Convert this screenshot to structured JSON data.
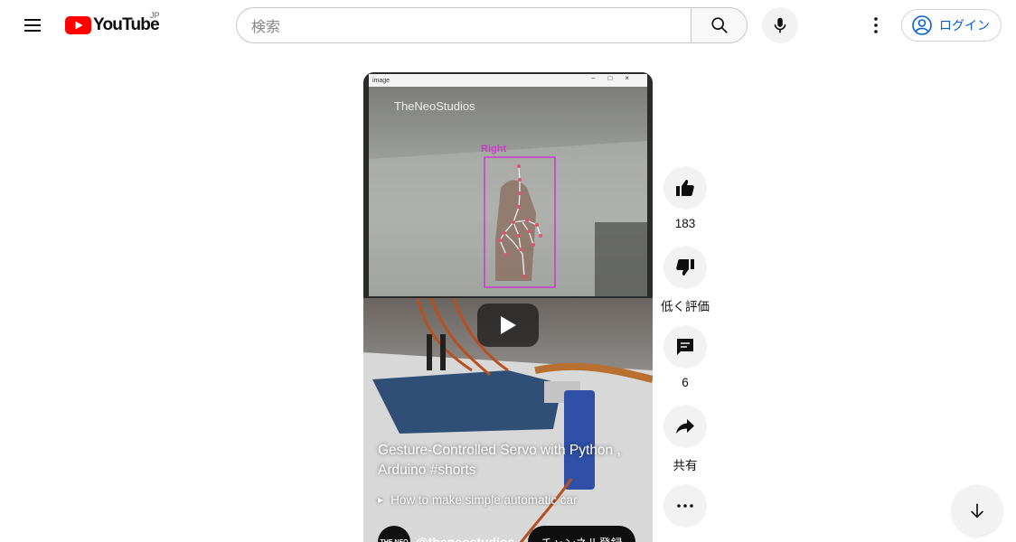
{
  "header": {
    "logo_text": "YouTube",
    "region": "JP",
    "search_placeholder": "検索",
    "login_label": "ログイン"
  },
  "video": {
    "window_title": "image",
    "watermark": "TheNeoStudios",
    "detection_label": "Right",
    "title": "Gesture-Controlled Servo with Python , Arduino #shorts",
    "related_link": "How to make simple automatic car",
    "channel_avatar_text": "THE NEO",
    "channel_name": "@theneostudios",
    "subscribe_label": "チャンネル登録"
  },
  "actions": {
    "likes": "183",
    "dislike_label": "低く評価",
    "comments": "6",
    "share_label": "共有"
  },
  "colors": {
    "youtube_red": "#ff0000",
    "link_blue": "#065fd4",
    "detection_magenta": "#c83cc8"
  },
  "icons": [
    "menu-icon",
    "youtube-logo-icon",
    "search-icon",
    "mic-icon",
    "more-vert-icon",
    "account-icon",
    "play-icon",
    "thumb-up-icon",
    "thumb-down-icon",
    "comment-icon",
    "share-icon",
    "more-horiz-icon",
    "arrow-down-icon"
  ]
}
